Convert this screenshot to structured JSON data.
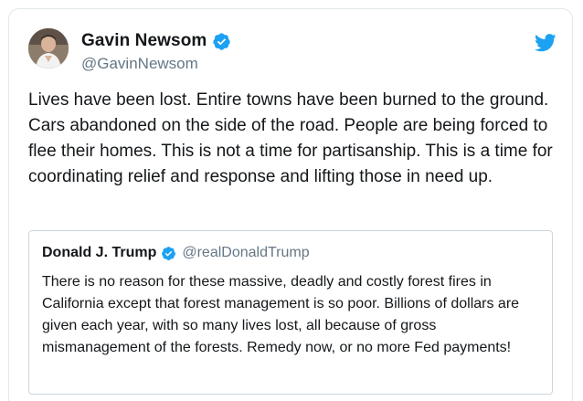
{
  "tweet": {
    "author": {
      "display_name": "Gavin Newsom",
      "handle": "@GavinNewsom",
      "verified": true,
      "avatar_icon": "avatar-photo-icon"
    },
    "text": "Lives have been lost. Entire towns have been burned to the ground. Cars abandoned on the side of the road. People are being forced to flee their homes. This is not a time for partisanship. This is a time for coordinating relief and response and lifting those in need up."
  },
  "quoted_tweet": {
    "author": {
      "display_name": "Donald J. Trump",
      "handle": "@realDonaldTrump",
      "verified": true
    },
    "text": "There is no reason for these massive, deadly and costly forest fires in California except that forest management is so poor. Billions of dollars are given each year, with so many lives lost, all because of gross mismanagement of the forests. Remedy now, or no more Fed payments!"
  },
  "icons": {
    "verified": "verified-badge-icon",
    "logo": "twitter-bird-icon"
  },
  "colors": {
    "verified_blue": "#1da1f2",
    "text": "#14171a",
    "secondary_text": "#657786",
    "border": "#e1e8ed"
  }
}
